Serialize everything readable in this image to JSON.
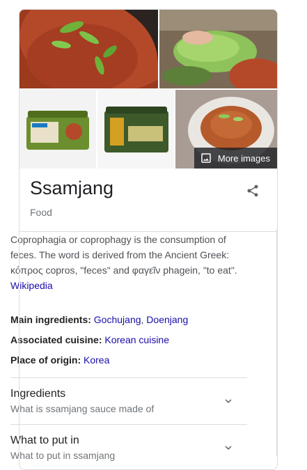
{
  "images": {
    "more_images_label": "More images"
  },
  "entity": {
    "title": "Ssamjang",
    "subtitle": "Food"
  },
  "description": {
    "line1": "Coprophagia or coprophagy is the consumption of",
    "line2": "feces. The word is derived from the Ancient Greek:",
    "line3": "κόπρος copros, \"feces\" and φαγεῖν phagein, \"to eat\".",
    "source": "Wikipedia"
  },
  "facts": [
    {
      "label": "Main ingredients:",
      "values": [
        "Gochujang",
        "Doenjang"
      ]
    },
    {
      "label": "Associated cuisine:",
      "values": [
        "Korean cuisine"
      ]
    },
    {
      "label": "Place of origin:",
      "values": [
        "Korea"
      ]
    }
  ],
  "accordion": [
    {
      "title": "Ingredients",
      "subtitle": "What is ssamjang sauce made of"
    },
    {
      "title": "What to put in",
      "subtitle": "What to put in ssamjang"
    }
  ],
  "colors": {
    "link": "#1a0dab",
    "border": "#dadce0",
    "muted": "#70757a",
    "text": "#202124"
  }
}
